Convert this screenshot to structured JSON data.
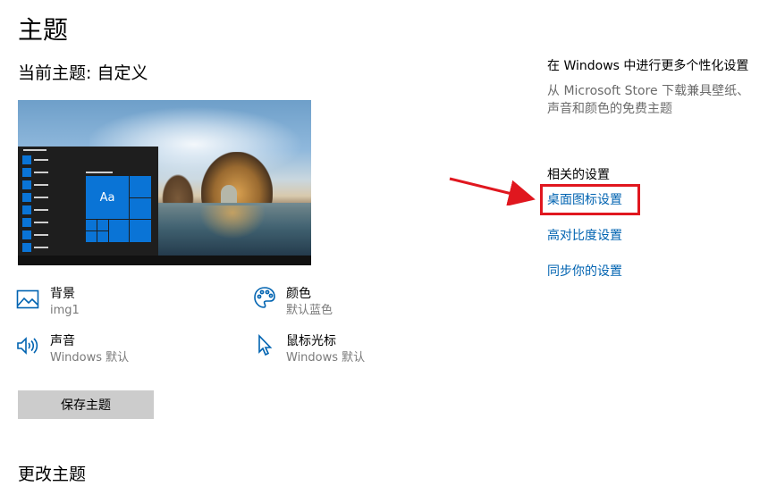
{
  "page": {
    "title": "主题",
    "current_theme": "当前主题: 自定义",
    "change_theme": "更改主题"
  },
  "preview": {
    "tile_label": "Aa"
  },
  "settings": {
    "background": {
      "title": "背景",
      "value": "img1",
      "icon": "picture-icon"
    },
    "color": {
      "title": "颜色",
      "value": "默认蓝色",
      "icon": "palette-icon"
    },
    "sound": {
      "title": "声音",
      "value": "Windows 默认",
      "icon": "speaker-icon"
    },
    "cursor": {
      "title": "鼠标光标",
      "value": "Windows 默认",
      "icon": "cursor-icon"
    }
  },
  "save_button": "保存主题",
  "right": {
    "personalize_heading": "在 Windows 中进行更多个性化设置",
    "personalize_desc": "从 Microsoft Store 下载兼具壁纸、声音和颜色的免费主题",
    "related_heading": "相关的设置",
    "links": [
      "桌面图标设置",
      "高对比度设置",
      "同步你的设置"
    ]
  },
  "colors": {
    "accent": "#0078d7",
    "link": "#0063b1",
    "highlight": "#e0171f",
    "button": "#cccccc"
  }
}
